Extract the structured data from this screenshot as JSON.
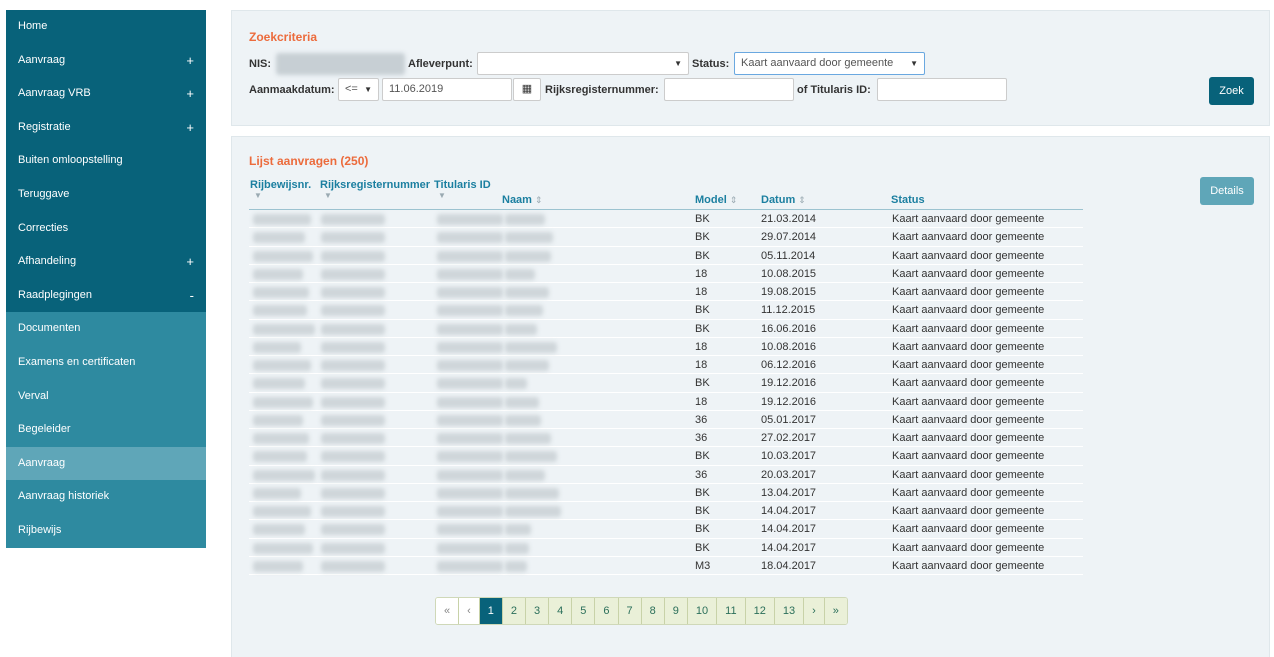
{
  "sidebar": {
    "items": [
      {
        "label": "Home",
        "sign": "",
        "state": "main"
      },
      {
        "label": "Aanvraag",
        "sign": "+",
        "state": "main"
      },
      {
        "label": "Aanvraag VRB",
        "sign": "+",
        "state": "main"
      },
      {
        "label": "Registratie",
        "sign": "+",
        "state": "main"
      },
      {
        "label": "Buiten omloopstelling",
        "sign": "",
        "state": "main"
      },
      {
        "label": "Teruggave",
        "sign": "",
        "state": "main"
      },
      {
        "label": "Correcties",
        "sign": "",
        "state": "main"
      },
      {
        "label": "Afhandeling",
        "sign": "+",
        "state": "main"
      },
      {
        "label": "Raadplegingen",
        "sign": "-",
        "state": "main"
      },
      {
        "label": "Documenten",
        "sign": "",
        "state": "sub"
      },
      {
        "label": "Examens en certificaten",
        "sign": "",
        "state": "sub"
      },
      {
        "label": "Verval",
        "sign": "",
        "state": "sub"
      },
      {
        "label": "Begeleider",
        "sign": "",
        "state": "sub"
      },
      {
        "label": "Aanvraag",
        "sign": "",
        "state": "active"
      },
      {
        "label": "Aanvraag historiek",
        "sign": "",
        "state": "sub"
      },
      {
        "label": "Rijbewijs",
        "sign": "",
        "state": "sub"
      }
    ]
  },
  "search": {
    "title": "Zoekcriteria",
    "nis_label": "NIS:",
    "afleverpunt_label": "Afleverpunt:",
    "afleverpunt_value": "",
    "status_label": "Status:",
    "status_value": "Kaart aanvaard door gemeente",
    "aanmaakdatum_label": "Aanmaakdatum:",
    "operator_value": "<=",
    "date_value": "11.06.2019",
    "calendar_icon": "calendar-icon",
    "rijksregister_label": "Rijksregisternummer:",
    "rijksregister_value": "",
    "titularis_label": "of Titularis ID:",
    "titularis_value": "",
    "search_button": "Zoek"
  },
  "list": {
    "title": "Lijst aanvragen (250)",
    "details_button": "Details",
    "columns": {
      "rijbewijsnr": "Rijbewijsnr.",
      "rijksregisternummer": "Rijksregisternummer",
      "titularis": "Titularis ID",
      "naam": "Naam",
      "model": "Model",
      "datum": "Datum",
      "status": "Status"
    },
    "sort_icon": "⇕",
    "rows": [
      {
        "model": "BK",
        "datum": "21.03.2014",
        "status": "Kaart aanvaard door gemeente"
      },
      {
        "model": "BK",
        "datum": "29.07.2014",
        "status": "Kaart aanvaard door gemeente"
      },
      {
        "model": "BK",
        "datum": "05.11.2014",
        "status": "Kaart aanvaard door gemeente"
      },
      {
        "model": "18",
        "datum": "10.08.2015",
        "status": "Kaart aanvaard door gemeente"
      },
      {
        "model": "18",
        "datum": "19.08.2015",
        "status": "Kaart aanvaard door gemeente"
      },
      {
        "model": "BK",
        "datum": "11.12.2015",
        "status": "Kaart aanvaard door gemeente"
      },
      {
        "model": "BK",
        "datum": "16.06.2016",
        "status": "Kaart aanvaard door gemeente"
      },
      {
        "model": "18",
        "datum": "10.08.2016",
        "status": "Kaart aanvaard door gemeente"
      },
      {
        "model": "18",
        "datum": "06.12.2016",
        "status": "Kaart aanvaard door gemeente"
      },
      {
        "model": "BK",
        "datum": "19.12.2016",
        "status": "Kaart aanvaard door gemeente"
      },
      {
        "model": "18",
        "datum": "19.12.2016",
        "status": "Kaart aanvaard door gemeente"
      },
      {
        "model": "36",
        "datum": "05.01.2017",
        "status": "Kaart aanvaard door gemeente"
      },
      {
        "model": "36",
        "datum": "27.02.2017",
        "status": "Kaart aanvaard door gemeente"
      },
      {
        "model": "BK",
        "datum": "10.03.2017",
        "status": "Kaart aanvaard door gemeente"
      },
      {
        "model": "36",
        "datum": "20.03.2017",
        "status": "Kaart aanvaard door gemeente"
      },
      {
        "model": "BK",
        "datum": "13.04.2017",
        "status": "Kaart aanvaard door gemeente"
      },
      {
        "model": "BK",
        "datum": "14.04.2017",
        "status": "Kaart aanvaard door gemeente"
      },
      {
        "model": "BK",
        "datum": "14.04.2017",
        "status": "Kaart aanvaard door gemeente"
      },
      {
        "model": "BK",
        "datum": "14.04.2017",
        "status": "Kaart aanvaard door gemeente"
      },
      {
        "model": "M3",
        "datum": "18.04.2017",
        "status": "Kaart aanvaard door gemeente"
      }
    ]
  },
  "pagination": {
    "first": "«",
    "prev": "‹",
    "pages": [
      "1",
      "2",
      "3",
      "4",
      "5",
      "6",
      "7",
      "8",
      "9",
      "10",
      "11",
      "12",
      "13"
    ],
    "current": "1",
    "next": "›",
    "last": "»"
  }
}
